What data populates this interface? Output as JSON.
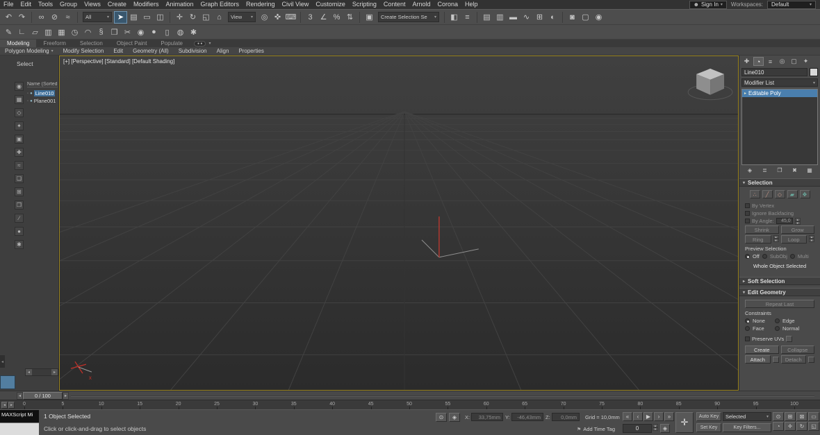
{
  "menu_bar": {
    "items": [
      "File",
      "Edit",
      "Tools",
      "Group",
      "Views",
      "Create",
      "Modifiers",
      "Animation",
      "Graph Editors",
      "Rendering",
      "Civil View",
      "Customize",
      "Scripting",
      "Content",
      "Arnold",
      "Corona",
      "Help"
    ]
  },
  "top_bar": {
    "sign_in": "Sign In",
    "workspaces_label": "Workspaces:",
    "workspace_value": "Default"
  },
  "toolbar_main": {
    "items": [
      {
        "type": "icon",
        "name": "undo-icon",
        "glyph": "↶"
      },
      {
        "type": "icon",
        "name": "redo-icon",
        "glyph": "↷"
      },
      {
        "type": "sep"
      },
      {
        "type": "icon",
        "name": "select-and-link-icon",
        "glyph": "∞"
      },
      {
        "type": "icon",
        "name": "unlink-selection-icon",
        "glyph": "⊘"
      },
      {
        "type": "icon",
        "name": "bind-to-space-warp-icon",
        "glyph": "≈"
      },
      {
        "type": "sep"
      },
      {
        "type": "dropdown",
        "name": "selection-filter-select",
        "label": "All",
        "w": 42
      },
      {
        "type": "icon",
        "name": "select-object-icon",
        "glyph": "➤",
        "active": true
      },
      {
        "type": "icon",
        "name": "select-by-name-icon",
        "glyph": "▤"
      },
      {
        "type": "icon",
        "name": "rectangular-selection-region-icon",
        "glyph": "▭"
      },
      {
        "type": "icon",
        "name": "window-crossing-toggle-icon",
        "glyph": "◫"
      },
      {
        "type": "sep"
      },
      {
        "type": "icon",
        "name": "select-and-move-icon",
        "glyph": "✛"
      },
      {
        "type": "icon",
        "name": "select-and-rotate-icon",
        "glyph": "↻"
      },
      {
        "type": "icon",
        "name": "select-and-scale-icon",
        "glyph": "◱"
      },
      {
        "type": "icon",
        "name": "select-and-place-icon",
        "glyph": "⌂"
      },
      {
        "type": "dropdown",
        "name": "reference-coordinate-select",
        "label": "View",
        "w": 40
      },
      {
        "type": "icon",
        "name": "use-pivot-point-center-icon",
        "glyph": "◎"
      },
      {
        "type": "icon",
        "name": "select-and-manipulate-icon",
        "glyph": "✜"
      },
      {
        "type": "icon",
        "name": "keyboard-shortcut-override-icon",
        "glyph": "⌨"
      },
      {
        "type": "sep"
      },
      {
        "type": "icon",
        "name": "snaps-toggle-icon",
        "glyph": "3"
      },
      {
        "type": "icon",
        "name": "angle-snap-icon",
        "glyph": "∠"
      },
      {
        "type": "icon",
        "name": "percent-snap-icon",
        "glyph": "%"
      },
      {
        "type": "icon",
        "name": "spinner-snap-icon",
        "glyph": "⇅"
      },
      {
        "type": "sep"
      },
      {
        "type": "icon",
        "name": "edit-named-selection-sets-icon",
        "glyph": "▣"
      },
      {
        "type": "dropdown",
        "name": "named-selection-sets-select",
        "label": "Create Selection Se",
        "w": 88
      },
      {
        "type": "sep"
      },
      {
        "type": "icon",
        "name": "mirror-icon",
        "glyph": "◧"
      },
      {
        "type": "icon",
        "name": "align-icon",
        "glyph": "≡"
      },
      {
        "type": "sep"
      },
      {
        "type": "icon",
        "name": "toggle-scene-explorer-icon",
        "glyph": "▤"
      },
      {
        "type": "icon",
        "name": "toggle-layer-explorer-icon",
        "glyph": "▥"
      },
      {
        "type": "icon",
        "name": "toggle-ribbon-icon",
        "glyph": "▬"
      },
      {
        "type": "icon",
        "name": "curve-editor-icon",
        "glyph": "∿"
      },
      {
        "type": "icon",
        "name": "schematic-view-icon",
        "glyph": "⊞"
      },
      {
        "type": "icon",
        "name": "material-editor-icon",
        "glyph": "◐"
      },
      {
        "type": "sep"
      },
      {
        "type": "icon",
        "name": "render-setup-icon",
        "glyph": "◙"
      },
      {
        "type": "icon",
        "name": "rendered-frame-window-icon",
        "glyph": "▢"
      },
      {
        "type": "icon",
        "name": "render-production-icon",
        "glyph": "◉"
      }
    ]
  },
  "toolbar_second": {
    "items": [
      {
        "name": "pencil-icon",
        "glyph": "✎"
      },
      {
        "name": "set-square-icon",
        "glyph": "∟"
      },
      {
        "name": "parallelogram-icon",
        "glyph": "▱"
      },
      {
        "name": "chart-icon",
        "glyph": "▥"
      },
      {
        "name": "grid-icon",
        "glyph": "▦"
      },
      {
        "name": "clock-icon",
        "glyph": "◷"
      },
      {
        "name": "arc-icon",
        "glyph": "◠"
      },
      {
        "name": "section-icon",
        "glyph": "§"
      },
      {
        "name": "box-icon",
        "glyph": "❒"
      },
      {
        "name": "scissors-icon",
        "glyph": "✂"
      },
      {
        "name": "eye-icon",
        "glyph": "◉"
      },
      {
        "name": "sphere-icon",
        "glyph": "●"
      },
      {
        "name": "cylinder-icon",
        "glyph": "▯"
      },
      {
        "name": "circle-icon",
        "glyph": "◍"
      },
      {
        "name": "star-icon",
        "glyph": "✱"
      }
    ]
  },
  "ribbon": {
    "tabs": [
      {
        "label": "Modeling",
        "active": true
      },
      {
        "label": "Freeform",
        "active": false
      },
      {
        "label": "Selection",
        "active": false
      },
      {
        "label": "Object Paint",
        "active": false
      },
      {
        "label": "Populate",
        "active": false
      }
    ],
    "panels": [
      {
        "label": "Polygon Modeling",
        "caret": true
      },
      {
        "label": "Modify Selection",
        "caret": false
      },
      {
        "label": "Edit",
        "caret": false
      },
      {
        "label": "Geometry (All)",
        "caret": false
      },
      {
        "label": "Subdivision",
        "caret": false
      },
      {
        "label": "Align",
        "caret": false
      },
      {
        "label": "Properties",
        "caret": false
      }
    ]
  },
  "scene_explorer": {
    "title": "Select",
    "column_header": "Name (Sorted A...",
    "rows": [
      {
        "label": "Line010",
        "selected": true
      },
      {
        "label": "Plane001",
        "selected": false
      }
    ],
    "filter_icons": [
      {
        "name": "display-all-icon",
        "glyph": "◉"
      },
      {
        "name": "display-geometry-icon",
        "glyph": "▦"
      },
      {
        "name": "display-shapes-icon",
        "glyph": "◇"
      },
      {
        "name": "display-lights-icon",
        "glyph": "✦"
      },
      {
        "name": "display-cameras-icon",
        "glyph": "▣"
      },
      {
        "name": "display-helpers-icon",
        "glyph": "✚"
      },
      {
        "name": "display-space-warps-icon",
        "glyph": "≈"
      },
      {
        "name": "display-groups-icon",
        "glyph": "❏"
      },
      {
        "name": "display-xrefs-icon",
        "glyph": "⊞"
      },
      {
        "name": "display-containers-icon",
        "glyph": "❒"
      },
      {
        "name": "display-bones-icon",
        "glyph": "∕"
      },
      {
        "name": "display-materials-icon",
        "glyph": "●"
      },
      {
        "name": "display-frozen-icon",
        "glyph": "✱"
      }
    ]
  },
  "viewport": {
    "label": "[+] [Perspective] [Standard] [Default Shading]",
    "axis_label": "x"
  },
  "command_panel": {
    "tabs": [
      {
        "name": "create-tab-icon",
        "glyph": "✚",
        "active": false
      },
      {
        "name": "modify-tab-icon",
        "glyph": "◔",
        "active": true
      },
      {
        "name": "hierarchy-tab-icon",
        "glyph": "≡",
        "active": false
      },
      {
        "name": "motion-tab-icon",
        "glyph": "◎",
        "active": false
      },
      {
        "name": "display-tab-icon",
        "glyph": "▢",
        "active": false
      },
      {
        "name": "utilities-tab-icon",
        "glyph": "✦",
        "active": false
      }
    ],
    "object_name": "Line010",
    "modifier_list_label": "Modifier List",
    "stack_item": "Editable Poly",
    "stack_tools": [
      {
        "name": "pin-stack-icon",
        "glyph": "◈"
      },
      {
        "name": "show-end-result-icon",
        "glyph": "≣"
      },
      {
        "name": "make-unique-icon",
        "glyph": "❐"
      },
      {
        "name": "remove-modifier-icon",
        "glyph": "✖"
      },
      {
        "name": "configure-modifier-sets-icon",
        "glyph": "▦"
      }
    ],
    "selection": {
      "title": "Selection",
      "subobject_icons": [
        {
          "name": "vertex-icon",
          "glyph": "∴"
        },
        {
          "name": "edge-icon",
          "glyph": "╱"
        },
        {
          "name": "border-icon",
          "glyph": "◇"
        },
        {
          "name": "polygon-icon",
          "glyph": "▰"
        },
        {
          "name": "element-icon",
          "glyph": "❖"
        }
      ],
      "by_vertex": "By Vertex",
      "ignore_backfacing": "Ignore Backfacing",
      "by_angle": "By Angle:",
      "angle_value": "45,0",
      "shrink": "Shrink",
      "grow": "Grow",
      "ring": "Ring",
      "loop": "Loop",
      "preview_label": "Preview Selection",
      "preview_off": "Off",
      "preview_subobj": "SubObj",
      "preview_multi": "Multi",
      "status_text": "Whole Object Selected"
    },
    "soft_selection_title": "Soft Selection",
    "edit_geometry": {
      "title": "Edit Geometry",
      "repeat_last": "Repeat Last",
      "constraints_label": "Constraints",
      "constraint_none": "None",
      "constraint_edge": "Edge",
      "constraint_face": "Face",
      "constraint_normal": "Normal",
      "preserve_uvs": "Preserve UVs",
      "create": "Create",
      "collapse": "Collapse",
      "attach": "Attach",
      "detach": "Detach"
    }
  },
  "timeline": {
    "slider_label": "0 / 100",
    "ticks": [
      "0",
      "5",
      "10",
      "15",
      "20",
      "25",
      "30",
      "35",
      "40",
      "45",
      "50",
      "55",
      "60",
      "65",
      "70",
      "75",
      "80",
      "85",
      "90",
      "95",
      "100"
    ]
  },
  "status_bar": {
    "maxscript_label": "MAXScript Mi",
    "status_line": "1 Object Selected",
    "prompt_line": "Click or click-and-drag to select objects",
    "coord_x_label": "X:",
    "coord_x_value": "33,75mm",
    "coord_y_label": "Y:",
    "coord_y_value": "-46,43mm",
    "coord_z_label": "Z:",
    "coord_z_value": "0,0mm",
    "grid_text": "Grid = 10,0mm",
    "add_time_tag": "Add Time Tag",
    "auto_key": "Auto Key",
    "set_key": "Set Key",
    "key_filters": "Key Filters...",
    "selected_set": "Selected",
    "frame_value": "0",
    "status_icons": [
      {
        "name": "isolate-selection-icon",
        "glyph": "⊙"
      },
      {
        "name": "lock-selection-icon",
        "glyph": "◈"
      }
    ],
    "playback": [
      {
        "name": "go-to-start-icon",
        "glyph": "«"
      },
      {
        "name": "previous-frame-icon",
        "glyph": "‹"
      },
      {
        "name": "play-icon",
        "glyph": "▶"
      },
      {
        "name": "next-frame-icon",
        "glyph": "›"
      },
      {
        "name": "go-to-end-icon",
        "glyph": "»"
      }
    ],
    "nav_icons": [
      {
        "name": "zoom-icon",
        "glyph": "⊙"
      },
      {
        "name": "zoom-all-icon",
        "glyph": "⊞"
      },
      {
        "name": "zoom-extents-icon",
        "glyph": "⊠"
      },
      {
        "name": "zoom-region-icon",
        "glyph": "▭"
      },
      {
        "name": "field-of-view-icon",
        "glyph": "◔"
      },
      {
        "name": "pan-icon",
        "glyph": "✛"
      },
      {
        "name": "orbit-icon",
        "glyph": "↻"
      },
      {
        "name": "maximize-viewport-icon",
        "glyph": "◱"
      }
    ]
  }
}
